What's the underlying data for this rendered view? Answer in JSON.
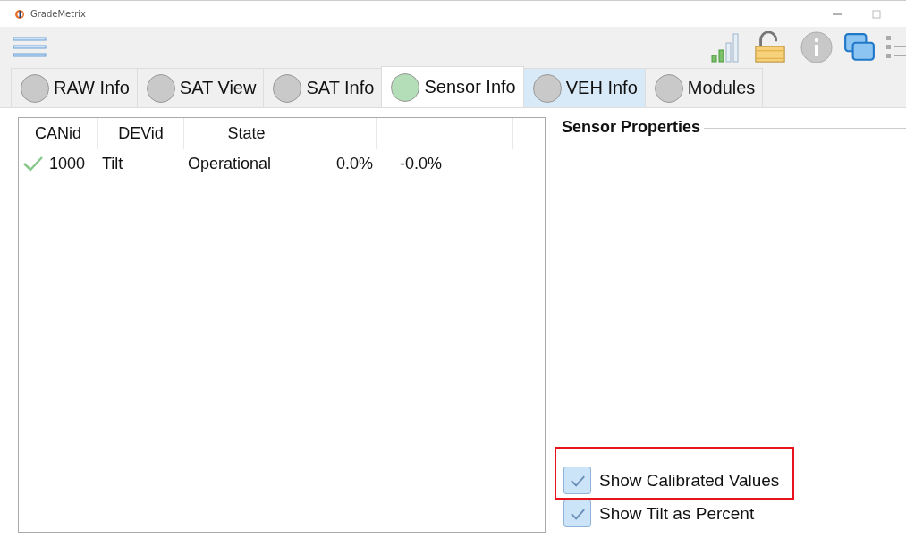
{
  "window": {
    "title": "GradeMetrix"
  },
  "tabs": [
    {
      "label": "RAW Info",
      "selected": false,
      "hovered": false,
      "color": "#c9c9c9"
    },
    {
      "label": "SAT View",
      "selected": false,
      "hovered": false,
      "color": "#c9c9c9"
    },
    {
      "label": "SAT Info",
      "selected": false,
      "hovered": false,
      "color": "#c9c9c9"
    },
    {
      "label": "Sensor Info",
      "selected": true,
      "hovered": false,
      "color": "#b4deb8"
    },
    {
      "label": "VEH Info",
      "selected": false,
      "hovered": true,
      "color": "#c9c9c9"
    },
    {
      "label": "Modules",
      "selected": false,
      "hovered": false,
      "color": "#c9c9c9"
    }
  ],
  "table": {
    "columns": [
      "CANid",
      "DEVid",
      "State"
    ],
    "rows": [
      {
        "ok": true,
        "cells": [
          "1000",
          "Tilt",
          "Operational",
          "0.0%",
          "-0.0%"
        ]
      }
    ]
  },
  "properties": {
    "title": "Sensor Properties",
    "checkboxes": [
      {
        "label": "Show Calibrated Values",
        "checked": true,
        "highlighted": true
      },
      {
        "label": "Show Tilt as Percent",
        "checked": true,
        "highlighted": false
      }
    ]
  }
}
